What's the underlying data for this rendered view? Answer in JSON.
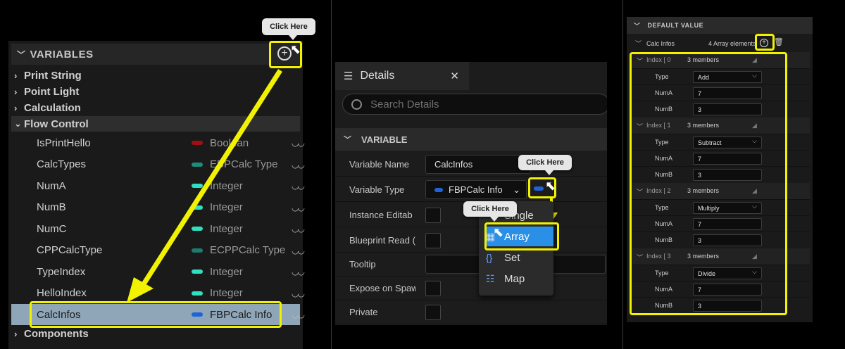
{
  "left": {
    "header": "VARIABLES",
    "categories": [
      "Print String",
      "Point Light",
      "Calculation",
      "Flow Control",
      "Components"
    ],
    "variables": [
      {
        "name": "IsPrintHello",
        "type": "Boolean",
        "color": "#a01010"
      },
      {
        "name": "CalcTypes",
        "type": "EBPCalc Type",
        "color": "#1e8c7a"
      },
      {
        "name": "NumA",
        "type": "Integer",
        "color": "#2ee0c0"
      },
      {
        "name": "NumB",
        "type": "Integer",
        "color": "#2ee0c0"
      },
      {
        "name": "NumC",
        "type": "Integer",
        "color": "#2ee0c0"
      },
      {
        "name": "CPPCalcType",
        "type": "ECPPCalc Type",
        "color": "#1e7a6c"
      },
      {
        "name": "TypeIndex",
        "type": "Integer",
        "color": "#2ee0c0"
      },
      {
        "name": "HelloIndex",
        "type": "Integer",
        "color": "#2ee0c0"
      },
      {
        "name": "CalcInfos",
        "type": "FBPCalc Info",
        "color": "#1f63d6"
      }
    ],
    "callout": "Click Here"
  },
  "mid": {
    "tab_title": "Details",
    "tab_close": "✕",
    "search_placeholder": "Search Details",
    "section": "VARIABLE",
    "props": [
      "Variable Name",
      "Variable Type",
      "Instance Editab",
      "Blueprint Read (",
      "Tooltip",
      "Expose on Spaw",
      "Private"
    ],
    "variable_name": "CalcInfos",
    "variable_type": "FBPCalc Info",
    "callout1": "Click Here",
    "callout2": "Click Here",
    "container_options": [
      "Single",
      "Array",
      "Set",
      "Map"
    ]
  },
  "right": {
    "header": "DEFAULT VALUE",
    "array_label": "Calc Infos",
    "array_count": "4 Array elements",
    "elements": [
      {
        "index": "Index [ 0",
        "members": "3 members",
        "type": "Add",
        "numa": "7",
        "numb": "3"
      },
      {
        "index": "Index [ 1",
        "members": "3 members",
        "type": "Subtract",
        "numa": "7",
        "numb": "3"
      },
      {
        "index": "Index [ 2",
        "members": "3 members",
        "type": "Multiply",
        "numa": "7",
        "numb": "3"
      },
      {
        "index": "Index [ 3",
        "members": "3 members",
        "type": "Divide",
        "numa": "7",
        "numb": "3"
      }
    ],
    "labels": {
      "type": "Type",
      "numa": "NumA",
      "numb": "NumB"
    }
  }
}
